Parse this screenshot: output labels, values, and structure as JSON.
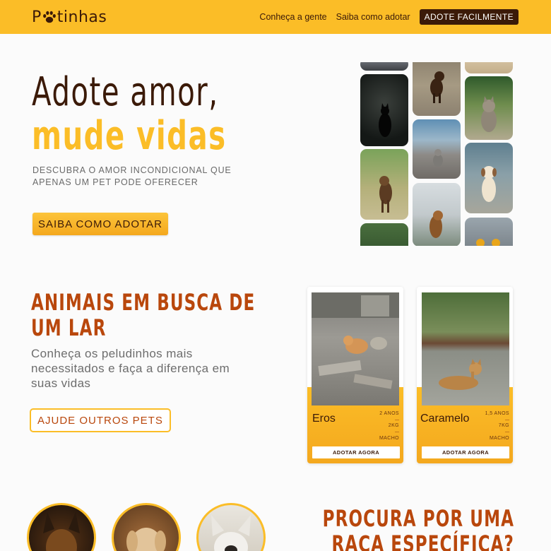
{
  "header": {
    "logo_text": "tinhas",
    "logo_icon": "paw-icon",
    "nav_links": [
      "Conheça a gente",
      "Saiba como adotar"
    ],
    "cta_label": "ADOTE FACILMENTE",
    "brand_color": "#fbbd27",
    "dark_color": "#3b1a08"
  },
  "hero": {
    "title_line1": "Adote amor,",
    "title_line2": "mude vidas",
    "subtitle": "DESCUBRA O AMOR INCONDICIONAL QUE APENAS UM PET PODE OFERECER",
    "button_label": "SAIBA COMO ADOTAR",
    "collage_photos": [
      "black-cat",
      "brown-puppy",
      "tabby-cat",
      "cat-on-street",
      "mixed-breed-dog",
      "beige-puppy",
      "brown-dog",
      "gray-cat-with-sunglasses"
    ]
  },
  "animals": {
    "title_line1": "ANIMAIS EM BUSCA DE",
    "title_line2": "UM LAR",
    "subtitle": "Conheça os peludinhos mais necessitados e faça a diferença em suas vidas",
    "button_label": "AJUDE OUTROS PETS",
    "accent_color": "#b9470c",
    "pets": [
      {
        "name": "Eros",
        "age": "2 ANOS",
        "weight": "2KG",
        "sex": "MACHO",
        "button_label": "ADOTAR AGORA",
        "photo": "orange-cat"
      },
      {
        "name": "Caramelo",
        "age": "1,5 ANOS",
        "weight": "7KG",
        "sex": "MACHO",
        "button_label": "ADOTAR AGORA",
        "photo": "caramel-dog"
      }
    ]
  },
  "breeds": {
    "title_line1": "PROCURA POR UMA",
    "title_line2": "RAÇA ESPECÍFICA?",
    "photos": [
      "german-shepherd",
      "golden-retriever",
      "french-bulldog"
    ]
  }
}
